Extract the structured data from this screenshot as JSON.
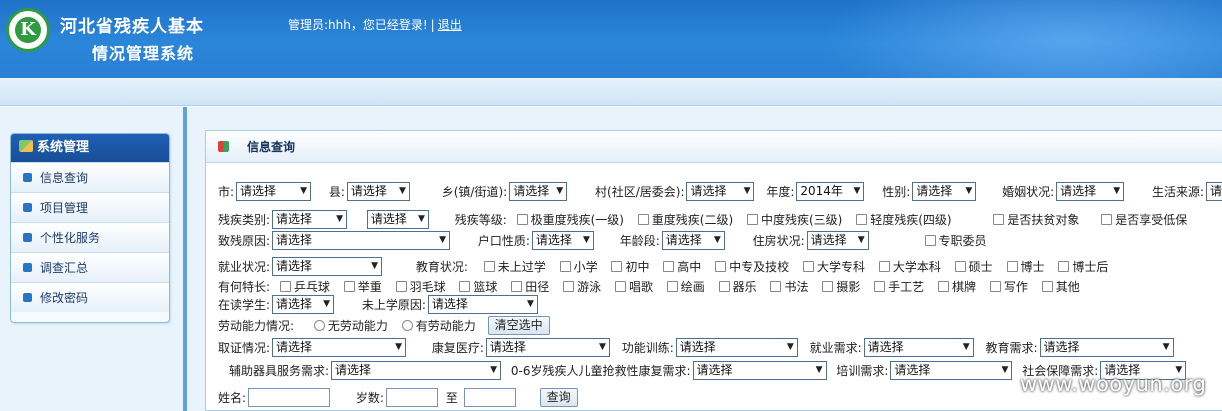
{
  "header": {
    "title_line1": "河北省残疾人基本",
    "title_line2": "情况管理系统",
    "logo_glyph": "K",
    "admin_prefix": "管理员:hhh，您已经登录!",
    "separator": "|",
    "logout": "退出"
  },
  "sidebar": {
    "title": "系统管理",
    "items": [
      {
        "label": "信息查询"
      },
      {
        "label": "项目管理"
      },
      {
        "label": "个性化服务"
      },
      {
        "label": "调查汇总"
      },
      {
        "label": "修改密码"
      }
    ]
  },
  "panel": {
    "title": "信息查询"
  },
  "form": {
    "r1": {
      "city": "市:",
      "city_v": "请选择",
      "county": "县:",
      "county_v": "请选择",
      "town": "乡(镇/街道):",
      "town_v": "请选择",
      "village": "村(社区/居委会):",
      "village_v": "请选择",
      "year": "年度:",
      "year_v": "2014年",
      "sex": "性别:",
      "sex_v": "请选择",
      "marriage": "婚姻状况:",
      "marriage_v": "请选择",
      "income": "生活来源:",
      "income_v": "请选"
    },
    "r2": {
      "dtype": "残疾类别:",
      "dtype_v1": "请选择",
      "dtype_v2": "请选择",
      "dlevel": "残疾等级:",
      "levels": [
        "极重度残疾(一级)",
        "重度残疾(二级)",
        "中度残疾(三级)",
        "轻度残疾(四级)"
      ],
      "poor": "是否扶贫对象",
      "dibao": "是否享受低保"
    },
    "r3": {
      "cause": "致残原因:",
      "cause_v": "请选择",
      "hukou": "户口性质:",
      "hukou_v": "请选择",
      "age": "年龄段:",
      "age_v": "请选择",
      "house": "住房状况:",
      "house_v": "请选择",
      "fulltime": "专职委员"
    },
    "r4": {
      "job": "就业状况:",
      "job_v": "请选择",
      "edu": "教育状况:",
      "edu_opts": [
        "未上过学",
        "小学",
        "初中",
        "高中",
        "中专及技校",
        "大学专科",
        "大学本科",
        "硕士",
        "博士",
        "博士后"
      ]
    },
    "r5": {
      "skill": "有何特长:",
      "skills": [
        "乒乓球",
        "举重",
        "羽毛球",
        "篮球",
        "田径",
        "游泳",
        "唱歌",
        "绘画",
        "器乐",
        "书法",
        "摄影",
        "手工艺",
        "棋牌",
        "写作",
        "其他"
      ]
    },
    "r6": {
      "student": "在读学生:",
      "student_v": "请选择",
      "noschool": "未上学原因:",
      "noschool_v": "请选择"
    },
    "r7": {
      "labor": "劳动能力情况:",
      "opt1": "无劳动能力",
      "opt2": "有劳动能力",
      "clear": "清空选中"
    },
    "r8": {
      "cert": "取证情况:",
      "cert_v": "请选择",
      "rehab": "康复医疗:",
      "rehab_v": "请选择",
      "train": "功能训练:",
      "train_v": "请选择",
      "jobneed": "就业需求:",
      "jobneed_v": "请选择",
      "eduneed": "教育需求:",
      "eduneed_v": "请选择"
    },
    "r9": {
      "aid": "辅助器具服务需求:",
      "aid_v": "请选择",
      "child": "0-6岁残疾人儿童抢救性康复需求:",
      "child_v": "请选择",
      "trainneed": "培训需求:",
      "trainneed_v": "请选择",
      "social": "社会保障需求:",
      "social_v": "请选择"
    },
    "r10": {
      "name": "姓名:",
      "ageof": "岁数:",
      "to": "至",
      "query": "查询"
    }
  },
  "watermark": "www.wooyun.org"
}
